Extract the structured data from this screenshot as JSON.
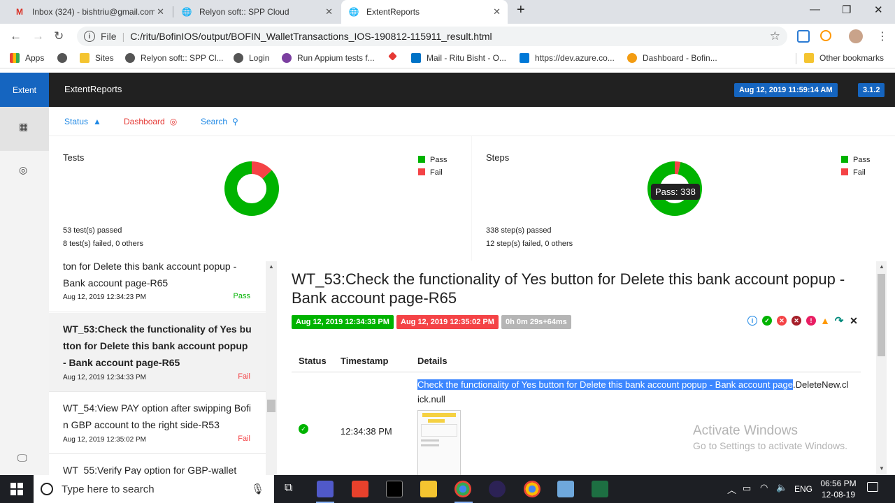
{
  "browser": {
    "tabs": [
      {
        "title": "Inbox (324) - bishtriu@gmail.com",
        "icon": "gmail-icon"
      },
      {
        "title": "Relyon soft:: SPP Cloud",
        "icon": "globe-icon"
      },
      {
        "title": "ExtentReports",
        "icon": "globe-icon"
      }
    ],
    "new_tab": "+",
    "file_label": "File",
    "url": "C:/ritu/BofinIOS/output/BOFIN_WalletTransactions_IOS-190812-115911_result.html",
    "bookmarks": [
      "Apps",
      "Sites",
      "Relyon soft:: SPP Cl...",
      "Login",
      "Run Appium tests f...",
      "Mail - Ritu Bisht - O...",
      "https://dev.azure.co...",
      "Dashboard - Bofin..."
    ],
    "other_bookmarks": "Other bookmarks"
  },
  "header": {
    "logo": "Extent",
    "title": "ExtentReports",
    "date": "Aug 12, 2019 11:59:14 AM",
    "version": "3.1.2"
  },
  "subnav": {
    "status": "Status",
    "dashboard": "Dashboard",
    "search": "Search"
  },
  "dashboard": {
    "tests": {
      "title": "Tests",
      "pass_label": "Pass",
      "fail_label": "Fail",
      "pass": 53,
      "fail": 8,
      "passed_text": "53 test(s) passed",
      "failed_text": "8 test(s) failed, 0 others"
    },
    "steps": {
      "title": "Steps",
      "pass_label": "Pass",
      "fail_label": "Fail",
      "pass": 338,
      "fail": 12,
      "tooltip": "Pass: 338",
      "passed_text": "338 step(s) passed",
      "failed_text": "12 step(s) failed, 0 others"
    },
    "colors": {
      "pass": "#00b300",
      "fail": "#f44346"
    }
  },
  "tests": [
    {
      "name": "ton for Delete this bank account popup - Bank account page-R65",
      "time": "Aug 12, 2019 12:34:23 PM",
      "status": "Pass"
    },
    {
      "name": "WT_53:Check the functionality of Yes button for Delete this bank account popup - Bank account page-R65",
      "time": "Aug 12, 2019 12:34:33 PM",
      "status": "Fail"
    },
    {
      "name": "WT_54:View PAY option after swipping Bofin GBP account to the right side-R53",
      "time": "Aug 12, 2019 12:35:02 PM",
      "status": "Fail"
    },
    {
      "name": "WT_55:Verify Pay option for GBP-wallet"
    }
  ],
  "detail": {
    "title": "WT_53:Check the functionality of Yes button for Delete this bank account popup - Bank account page-R65",
    "start": "Aug 12, 2019 12:34:33 PM",
    "end": "Aug 12, 2019 12:35:02 PM",
    "duration": "0h 0m 29s+64ms",
    "cols": {
      "status": "Status",
      "timestamp": "Timestamp",
      "details": "Details"
    },
    "row": {
      "timestamp": "12:34:38 PM",
      "details_highlight": "Check the functionality of Yes button for Delete this bank account popup - Bank account page",
      "details_rest_1": ".DeleteNew.cl",
      "details_rest_2": "ick.null"
    },
    "watermark_title": "Activate Windows",
    "watermark_sub": "Go to Settings to activate Windows."
  },
  "taskbar": {
    "search_placeholder": "Type here to search",
    "lang": "ENG",
    "time": "06:56 PM",
    "date": "12-08-19"
  }
}
